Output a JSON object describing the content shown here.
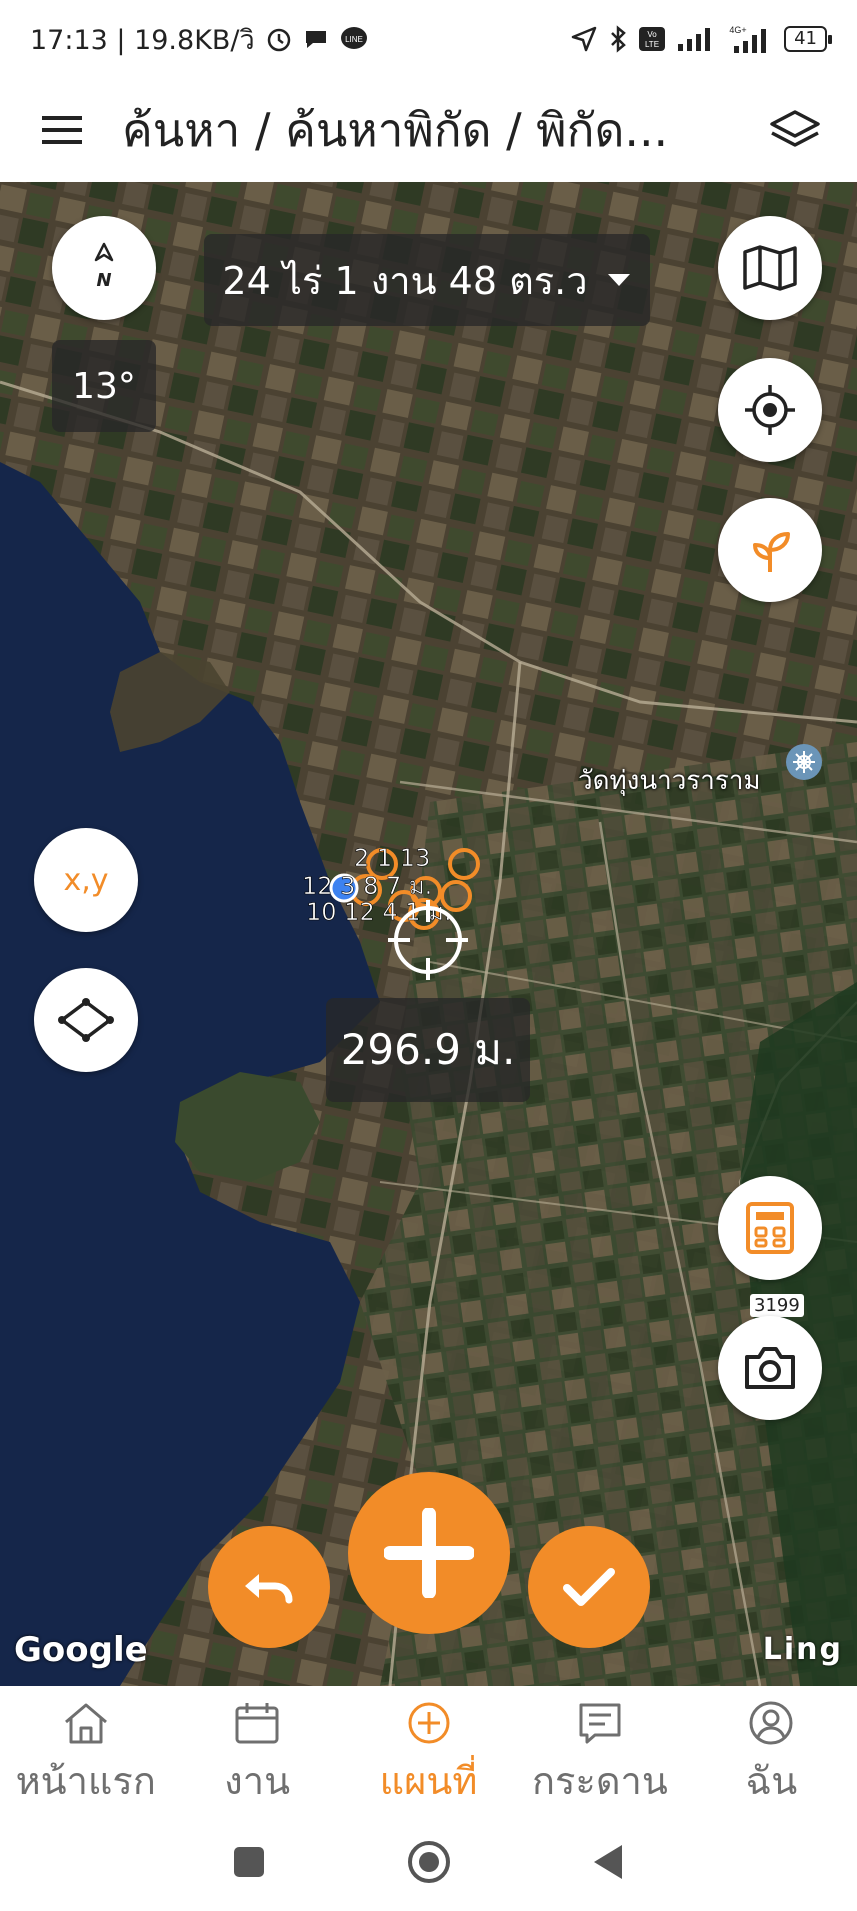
{
  "status_bar": {
    "time_and_speed": "17:13 | 19.8KB/วิ",
    "battery": "41",
    "network": "4G+"
  },
  "app_bar": {
    "title": "ค้นหา / ค้นหาพิกัด / พิกัด..."
  },
  "map": {
    "area_text": "24 ไร่ 1 งาน 48 ตร.ว",
    "heading_text": "13°",
    "compass_letter": "N",
    "xy_label": "x,y",
    "distance_text": "296.9 ม.",
    "place_name": "วัดทุ่งนาวราราม",
    "road_number": "3199",
    "attribution_left": "Google",
    "attribution_right": "Ling",
    "points_label_top": "2 1 13",
    "points_label_mid": "12 3 8 7 ม.",
    "points_label_bot": "10 12 4 1 ม."
  },
  "bottom_nav": {
    "items": [
      {
        "label": "หน้าแรก",
        "icon": "home-icon"
      },
      {
        "label": "งาน",
        "icon": "calendar-icon"
      },
      {
        "label": "แผนที่",
        "icon": "plus-circle-icon"
      },
      {
        "label": "กระดาน",
        "icon": "board-icon"
      },
      {
        "label": "ฉัน",
        "icon": "user-icon"
      }
    ],
    "active_index": 2
  },
  "colors": {
    "accent": "#f28c28",
    "inactive": "#6f6f6f"
  }
}
